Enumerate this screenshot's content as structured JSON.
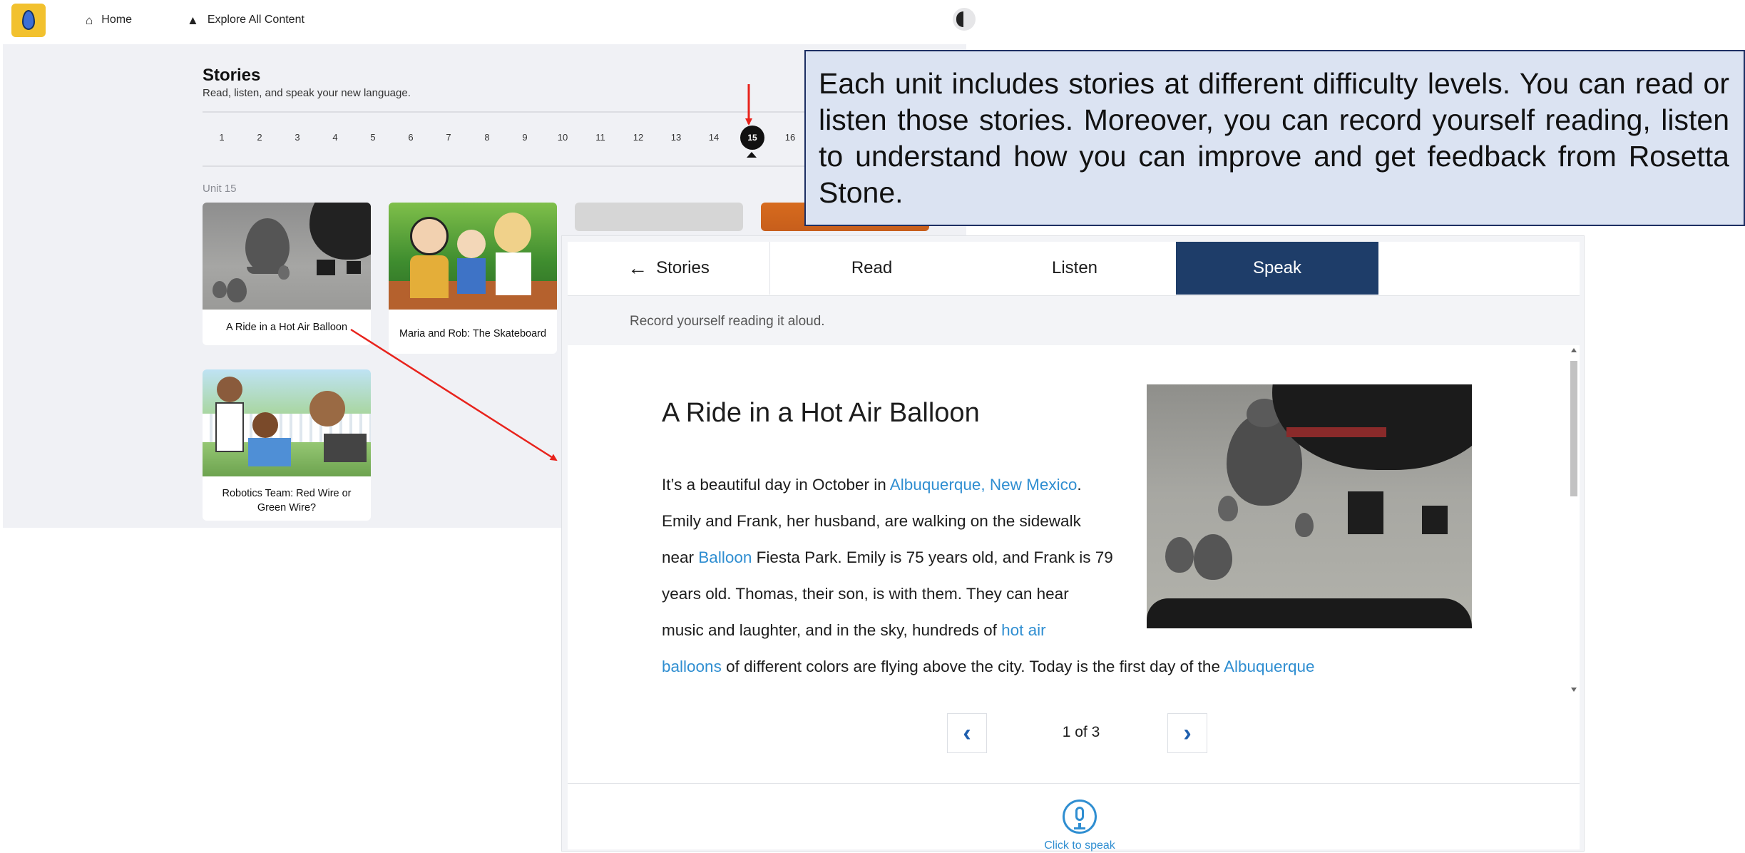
{
  "nav": {
    "home_label": "Home",
    "explore_label": "Explore All Content"
  },
  "stories": {
    "title": "Stories",
    "subtitle": "Read, listen, and speak your new language.",
    "units": [
      "1",
      "2",
      "3",
      "4",
      "5",
      "6",
      "7",
      "8",
      "9",
      "10",
      "11",
      "12",
      "13",
      "14",
      "15",
      "16"
    ],
    "active_unit": "15",
    "unit_label": "Unit 15",
    "cards": [
      {
        "title": "A Ride in a Hot Air Balloon"
      },
      {
        "title": "Maria and Rob: The Skateboard"
      },
      {
        "title": "Robotics Team: Red Wire or Green Wire?"
      }
    ]
  },
  "panel": {
    "tabs": {
      "back": "Stories",
      "read": "Read",
      "listen": "Listen",
      "speak": "Speak"
    },
    "instruction": "Record yourself reading it aloud.",
    "story_title": "A Ride in a Hot Air Balloon",
    "story_lines": [
      {
        "a": "It’s a beautiful day in October in ",
        "link": "Albuquerque, New Mexico",
        "b": "."
      },
      {
        "a": "Emily and Frank, her husband, are walking on the sidewalk",
        "link": "",
        "b": ""
      },
      {
        "a": "near ",
        "link": "Balloon",
        "b": " Fiesta Park. Emily is 75 years old, and Frank is 79"
      },
      {
        "a": "years old. Thomas, their son, is with them. They can hear",
        "link": "",
        "b": ""
      },
      {
        "a": "music and laughter, and in the sky, hundreds of ",
        "link": "hot air",
        "b": ""
      },
      {
        "a": "",
        "link": "balloons",
        "b": " of different colors are flying above the city. Today is the first day of the ",
        "link2": "Albuquerque"
      }
    ],
    "pager": {
      "count": "1 of 3"
    },
    "speak_label": "Click to speak"
  },
  "callout": {
    "text": "Each unit includes stories at different difficulty levels. You can read or listen those stories. Moreover, you can record yourself reading, listen to understand how you can improve and get feedback from Rosetta Stone."
  },
  "colors": {
    "accent_navy": "#1e3d69",
    "link_blue": "#2f8ed1",
    "logo_yellow": "#f2c12e",
    "annotation_red": "#e8231c",
    "callout_fill": "#dbe3f2"
  },
  "icons": {
    "home": "home-icon",
    "explore": "shapes-icon",
    "back": "arrow-left-icon",
    "prev": "chevron-left-icon",
    "next": "chevron-right-icon",
    "mic": "microphone-icon"
  }
}
